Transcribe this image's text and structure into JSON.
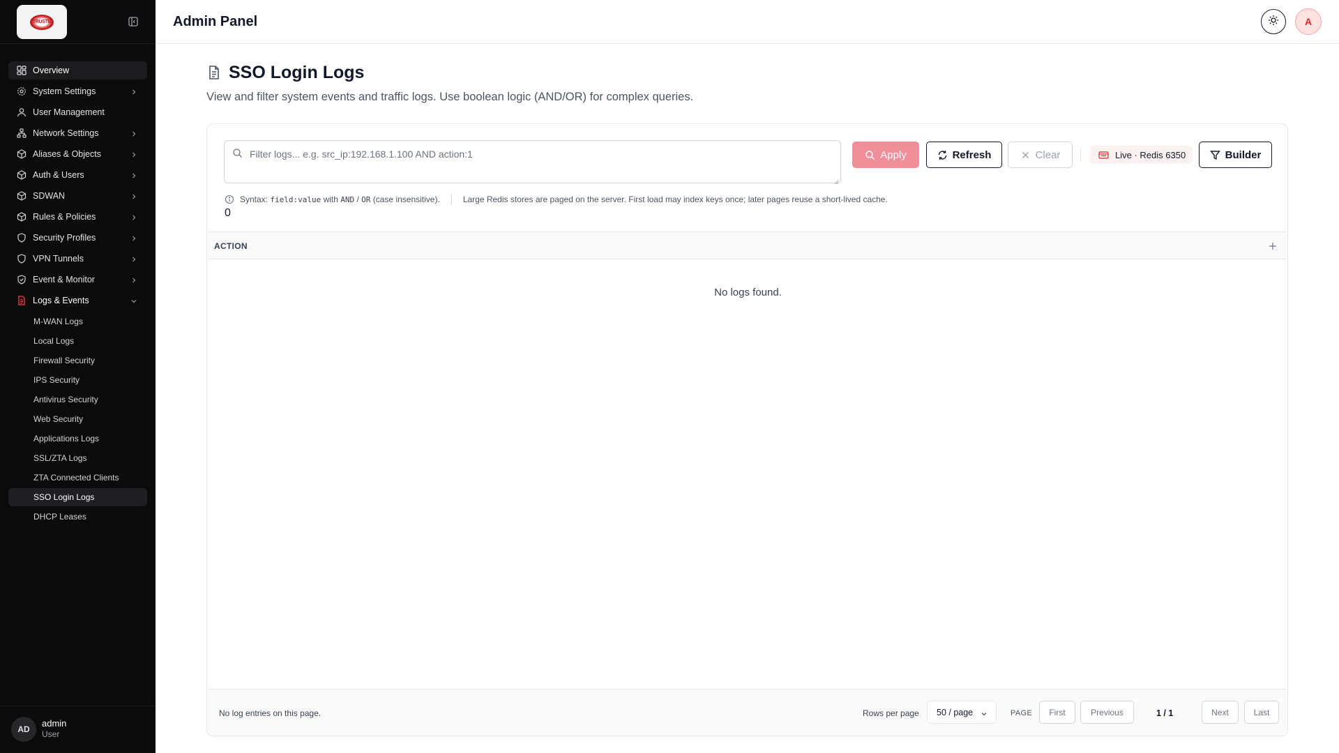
{
  "brand": {
    "logo_text": "TRUSTE"
  },
  "header": {
    "title": "Admin Panel",
    "avatar_initial": "A"
  },
  "sidebar": {
    "items": [
      {
        "label": "Overview"
      },
      {
        "label": "System Settings"
      },
      {
        "label": "User Management"
      },
      {
        "label": "Network Settings"
      },
      {
        "label": "Aliases & Objects"
      },
      {
        "label": "Auth & Users"
      },
      {
        "label": "SDWAN"
      },
      {
        "label": "Rules & Policies"
      },
      {
        "label": "Security Profiles"
      },
      {
        "label": "VPN Tunnels"
      },
      {
        "label": "Event & Monitor"
      },
      {
        "label": "Logs & Events"
      }
    ],
    "sub_items": [
      {
        "label": "M-WAN Logs"
      },
      {
        "label": "Local Logs"
      },
      {
        "label": "Firewall Security"
      },
      {
        "label": "IPS Security"
      },
      {
        "label": "Antivirus Security"
      },
      {
        "label": "Web Security"
      },
      {
        "label": "Applications Logs"
      },
      {
        "label": "SSL/ZTA Logs"
      },
      {
        "label": "ZTA Connected Clients"
      },
      {
        "label": "SSO Login Logs"
      },
      {
        "label": "DHCP Leases"
      }
    ],
    "user": {
      "initials": "AD",
      "name": "admin",
      "role": "User"
    }
  },
  "page": {
    "title": "SSO Login Logs",
    "description": "View and filter system events and traffic logs. Use boolean logic (AND/OR) for complex queries."
  },
  "filter": {
    "placeholder": "Filter logs... e.g. src_ip:192.168.1.100 AND action:1",
    "value": "",
    "apply_label": "Apply",
    "refresh_label": "Refresh",
    "clear_label": "Clear",
    "live_badge": "Live · Redis 6350",
    "builder_label": "Builder",
    "syntax_prefix": "Syntax:",
    "syntax_code": "field:value",
    "syntax_with": "with",
    "syntax_and": "AND",
    "syntax_slash": "/",
    "syntax_or": "OR",
    "syntax_suffix": "(case insensitive).",
    "redis_note": "Large Redis stores are paged on the server. First load may index keys once; later pages reuse a short-lived cache.",
    "result_count": "0"
  },
  "table": {
    "columns": [
      "ACTION"
    ],
    "rows": [],
    "empty_message": "No logs found."
  },
  "pagination": {
    "entries_note": "No log entries on this page.",
    "rows_per_page_label": "Rows per page",
    "rows_per_page_value": "50 / page",
    "page_label": "PAGE",
    "first_label": "First",
    "previous_label": "Previous",
    "page_indicator": "1 / 1",
    "next_label": "Next",
    "last_label": "Last"
  },
  "colors": {
    "accent": "#dc2626",
    "apply_bg": "#f08f9a",
    "sidebar_bg": "#0b0b0b"
  }
}
